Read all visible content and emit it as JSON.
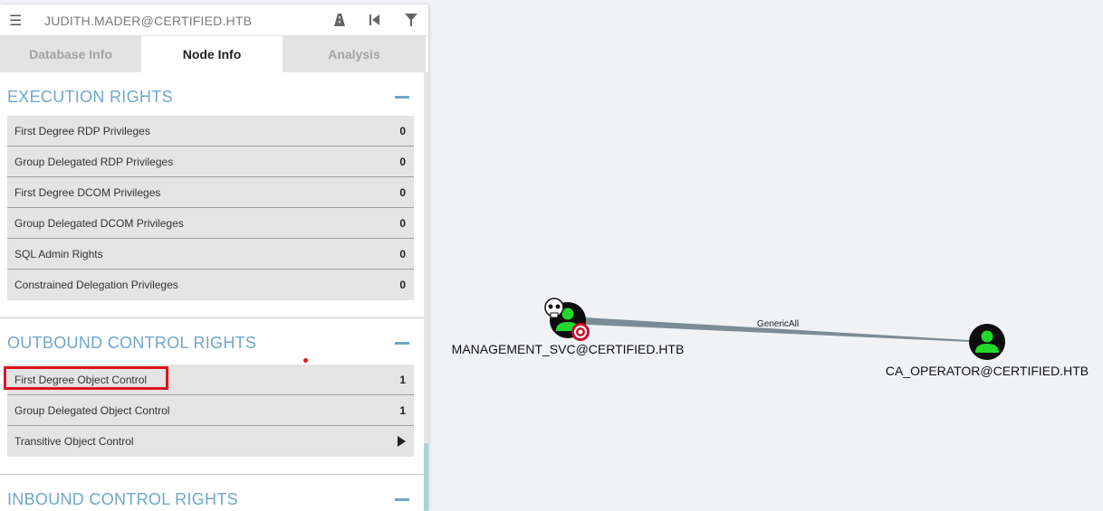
{
  "search": {
    "query": "JUDITH.MADER@CERTIFIED.HTB"
  },
  "tabs": [
    {
      "label": "Database Info"
    },
    {
      "label": "Node Info"
    },
    {
      "label": "Analysis"
    }
  ],
  "execution_rights": {
    "title": "EXECUTION RIGHTS",
    "rows": [
      {
        "label": "First Degree RDP Privileges",
        "count": "0"
      },
      {
        "label": "Group Delegated RDP Privileges",
        "count": "0"
      },
      {
        "label": "First Degree DCOM Privileges",
        "count": "0"
      },
      {
        "label": "Group Delegated DCOM Privileges",
        "count": "0"
      },
      {
        "label": "SQL Admin Rights",
        "count": "0"
      },
      {
        "label": "Constrained Delegation Privileges",
        "count": "0"
      }
    ]
  },
  "outbound_control_rights": {
    "title": "OUTBOUND CONTROL RIGHTS",
    "rows": [
      {
        "label": "First Degree Object Control",
        "count": "1"
      },
      {
        "label": "Group Delegated Object Control",
        "count": "1"
      },
      {
        "label": "Transitive Object Control"
      }
    ]
  },
  "inbound_control_rights": {
    "title": "INBOUND CONTROL RIGHTS"
  },
  "graph": {
    "nodes": [
      {
        "label": "MANAGEMENT_SVC@CERTIFIED.HTB",
        "owned": true,
        "target": true
      },
      {
        "label": "CA_OPERATOR@CERTIFIED.HTB"
      }
    ],
    "edge": {
      "label": "GenericAll"
    }
  },
  "colors": {
    "accent": "#6ea7c9",
    "highlight": "#e0141e",
    "node_fill": "#21d92b",
    "edge": "#7a8c96"
  }
}
